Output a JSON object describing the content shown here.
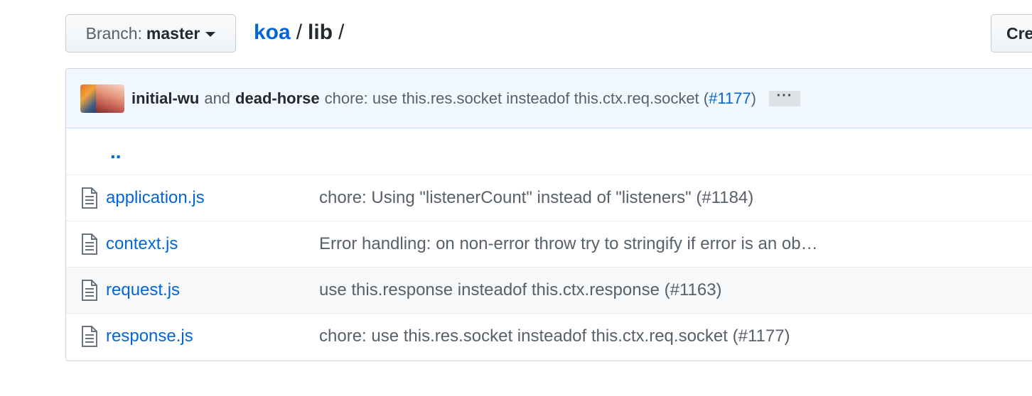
{
  "branch": {
    "prefix": "Branch:",
    "name": "master"
  },
  "breadcrumb": {
    "repo": "koa",
    "separator": "/",
    "dir": "lib",
    "trailing": "/"
  },
  "create_button": {
    "label": "Create new file"
  },
  "latest_commit": {
    "author1": "initial-wu",
    "conjunction": "and",
    "author2": "dead-horse",
    "message": "chore: use this.res.socket insteadof this.ctx.req.socket (",
    "pr": "#1177",
    "message_end": ")",
    "ellipsis": "···"
  },
  "parent_dir": {
    "label": ".."
  },
  "files": [
    {
      "name": "application.js",
      "message": "chore: Using \"listenerCount\" instead of \"listeners\" (#1184)"
    },
    {
      "name": "context.js",
      "message": "Error handling: on non-error throw try to stringify if error is an ob…"
    },
    {
      "name": "request.js",
      "message": "use this.response insteadof this.ctx.response (#1163)"
    },
    {
      "name": "response.js",
      "message": "chore: use this.res.socket insteadof this.ctx.req.socket (#1177)"
    }
  ],
  "colors": {
    "link": "#0366d6",
    "commit_bg": "#f1f8ff",
    "muted_text": "#586069"
  }
}
